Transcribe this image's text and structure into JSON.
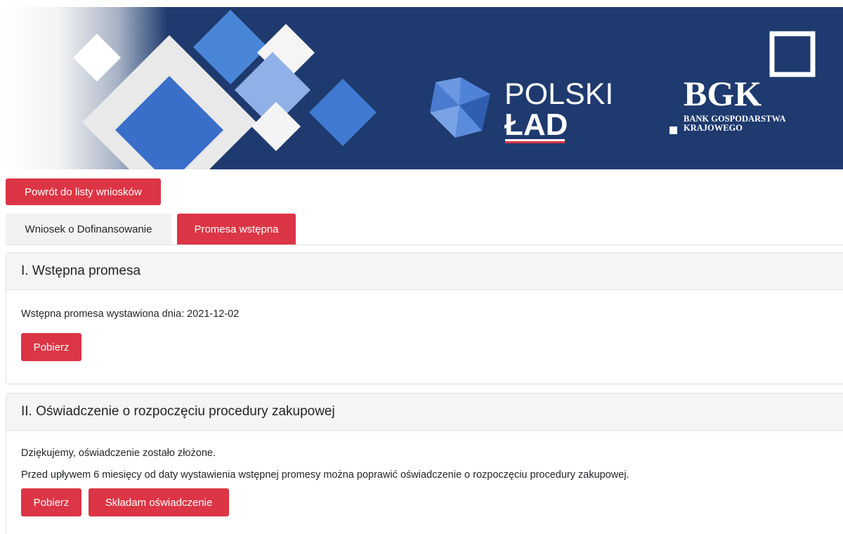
{
  "banner": {
    "logo_text_1": "POLSKI",
    "logo_text_2": "ŁAD",
    "bank_abbr": "BGK",
    "bank_line_1": "BANK GOSPODARSTWA",
    "bank_line_2": "KRAJOWEGO",
    "colors": {
      "background": "#1e3a6e",
      "accent_red": "#dc3545",
      "diamond_blue": "#3a6fc9"
    }
  },
  "nav": {
    "back_label": "Powrót do listy wniosków"
  },
  "tabs": [
    {
      "label": "Wniosek o Dofinansowanie",
      "active": false
    },
    {
      "label": "Promesa wstępna",
      "active": true
    }
  ],
  "section1": {
    "title": "I. Wstępna promesa",
    "issued_text": "Wstępna promesa wystawiona dnia: 2021-12-02",
    "download_label": "Pobierz"
  },
  "section2": {
    "title": "II. Oświadczenie o rozpoczęciu procedury zakupowej",
    "thanks_text": "Dziękujemy, oświadczenie zostało złożone.",
    "info_text": "Przed upływem 6 miesięcy od daty wystawienia wstępnej promesy można poprawić oświadczenie o rozpoczęciu procedury zakupowej.",
    "download_label": "Pobierz",
    "submit_label": "Składam oświadczenie"
  }
}
